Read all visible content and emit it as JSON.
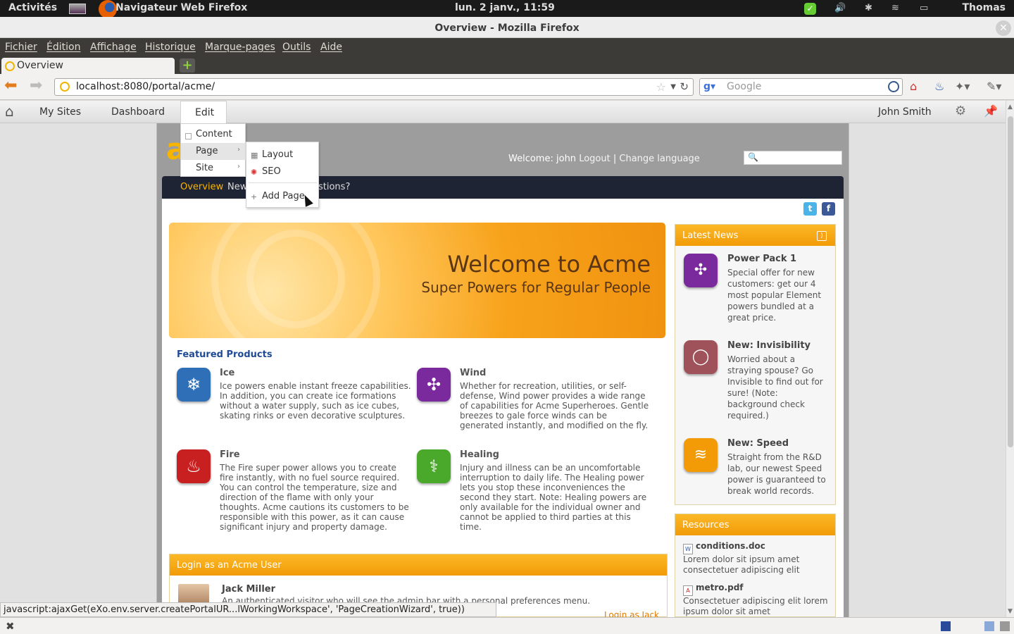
{
  "gnome_panel": {
    "activities": "Activités",
    "app_name": "Navigateur Web Firefox",
    "clock": "lun.  2 janv., 11:59",
    "user": "Thomas"
  },
  "window": {
    "title": "Overview - Mozilla Firefox"
  },
  "menubar": [
    "Fichier",
    "Édition",
    "Affichage",
    "Historique",
    "Marque-pages",
    "Outils",
    "Aide"
  ],
  "tabs": [
    {
      "label": "Overview"
    }
  ],
  "navbar": {
    "url": "localhost:8080/portal/acme/",
    "search_placeholder": "Google"
  },
  "admin_bar": {
    "my_sites": "My Sites",
    "dashboard": "Dashboard",
    "edit": "Edit",
    "user_name": "John Smith"
  },
  "edit_menu": {
    "items": [
      {
        "label": "Content"
      },
      {
        "label": "Page",
        "active": true
      },
      {
        "label": "Site"
      }
    ],
    "page_submenu": [
      "Layout",
      "SEO",
      "Add Page"
    ]
  },
  "portal_header": {
    "welcome_label": "Welcome:",
    "username": "john",
    "logout": "Logout",
    "separator": "|",
    "change_language": "Change language"
  },
  "site_nav": [
    "Overview",
    "New",
    "stions?"
  ],
  "banner": {
    "title": "Welcome to Acme",
    "subtitle": "Super Powers for Regular People"
  },
  "featured": {
    "title": "Featured Products",
    "products": [
      {
        "name": "Ice",
        "icon": "snowflake-icon",
        "color": "#2f6fb8",
        "description": "Ice powers enable instant freeze capabilities. In addition, you can create ice formations without a water supply, such as ice cubes, skating rinks or even decorative sculptures."
      },
      {
        "name": "Wind",
        "icon": "elements-icon",
        "color": "#7a2a9c",
        "description": "Whether for recreation, utilities, or self-defense, Wind power provides a wide range of capabilities for Acme Superheroes. Gentle breezes to gale force winds can be generated instantly, and modified on the fly."
      },
      {
        "name": "Fire",
        "icon": "flame-icon",
        "color": "#c82020",
        "description": "The Fire super power allows you to create fire instantly, with no fuel source required. You can control the temperature, size and direction of the flame with only your thoughts. Acme cautions its customers to be responsible with this power, as it can cause significant injury and property damage."
      },
      {
        "name": "Healing",
        "icon": "caduceus-icon",
        "color": "#4aa82a",
        "description": "Injury and illness can be an uncomfortable interruption to daily life. The Healing power lets you stop these inconveniences the second they start. Note: Healing powers are only available for the individual owner and cannot be applied to third parties at this time."
      }
    ]
  },
  "login_box": {
    "title": "Login as an Acme User",
    "user_name": "Jack Miller",
    "user_desc": "An authenticated visitor who will see the admin bar with a personal preferences menu.",
    "login_link": "Login as Jack"
  },
  "latest_news": {
    "title": "Latest News",
    "items": [
      {
        "title": "Power Pack 1",
        "icon": "elements-icon",
        "color": "#7a2a9c",
        "description": "Special offer for new customers: get our 4 most popular Element powers bundled at a great price."
      },
      {
        "title": "New: Invisibility",
        "icon": "invisibility-icon",
        "color": "#a0525a",
        "description": "Worried about a straying spouse? Go Invisible to find out for sure! (Note: background check required.)"
      },
      {
        "title": "New: Speed",
        "icon": "speed-shoe-icon",
        "color": "#f29b07",
        "description": "Straight from the R&D lab, our newest Speed power is guaranteed to break world records."
      }
    ]
  },
  "resources": {
    "title": "Resources",
    "items": [
      {
        "file": "conditions.doc",
        "description": "Lorem dolor sit ipsum amet consectetuer adipiscing elit"
      },
      {
        "file": "metro.pdf",
        "description": "Consectetuer adipiscing elit lorem ipsum dolor sit amet"
      }
    ]
  },
  "status_tip": "javascript:ajaxGet(eXo.env.server.createPortalUR...lWorkingWorkspace', 'PageCreationWizard', true))"
}
